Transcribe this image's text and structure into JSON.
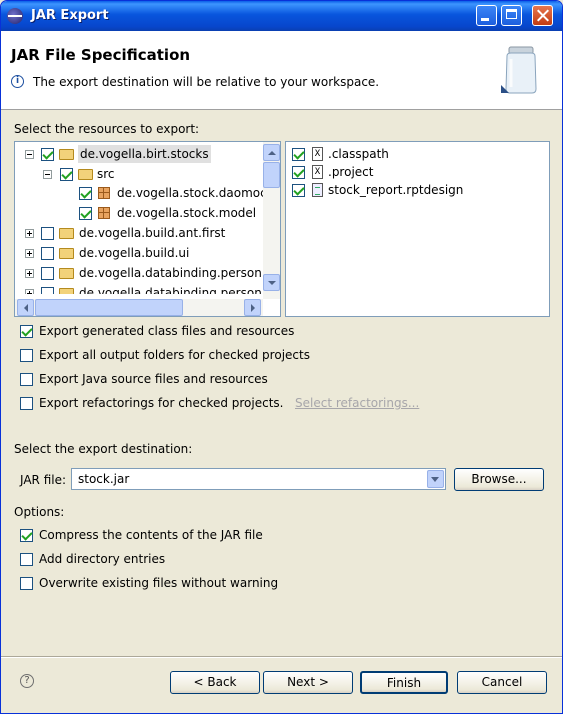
{
  "window": {
    "title": "JAR Export"
  },
  "banner": {
    "title": "JAR File Specification",
    "message": "The export destination will be relative to your workspace."
  },
  "resources": {
    "label": "Select the resources to export:",
    "tree": [
      {
        "label": "de.vogella.birt.stocks",
        "checked": true,
        "expanded": true
      },
      {
        "label": "src",
        "checked": true,
        "expanded": true
      },
      {
        "label": "de.vogella.stock.daomock",
        "checked": true
      },
      {
        "label": "de.vogella.stock.model",
        "checked": true
      },
      {
        "label": "de.vogella.build.ant.first",
        "checked": false
      },
      {
        "label": "de.vogella.build.ui",
        "checked": false
      },
      {
        "label": "de.vogella.databinding.person",
        "checked": false
      },
      {
        "label": "de.vogella.databinding.person",
        "checked": false
      }
    ],
    "files": [
      {
        "label": ".classpath",
        "checked": true
      },
      {
        "label": ".project",
        "checked": true
      },
      {
        "label": "stock_report.rptdesign",
        "checked": true
      }
    ]
  },
  "options_top": [
    {
      "label": "Export generated class files and resources",
      "checked": true
    },
    {
      "label": "Export all output folders for checked projects",
      "checked": false
    },
    {
      "label": "Export Java source files and resources",
      "checked": false
    },
    {
      "label": "Export refactorings for checked projects.",
      "checked": false
    }
  ],
  "select_refactorings": "Select refactorings...",
  "destination": {
    "label": "Select the export destination:",
    "jar_label": "JAR file:",
    "jar_value": "stock.jar",
    "browse": "Browse..."
  },
  "options": {
    "label": "Options:",
    "items": [
      {
        "label": "Compress the contents of the JAR file",
        "checked": true
      },
      {
        "label": "Add directory entries",
        "checked": false
      },
      {
        "label": "Overwrite existing files without warning",
        "checked": false
      }
    ]
  },
  "buttons": {
    "back": "< Back",
    "next": "Next >",
    "finish": "Finish",
    "cancel": "Cancel"
  },
  "help_icon": "?",
  "info_icon": "i"
}
